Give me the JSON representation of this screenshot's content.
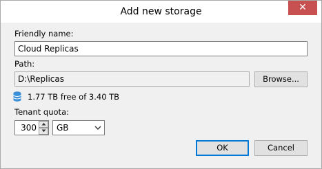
{
  "window": {
    "title": "Add new storage",
    "close_glyph": "✕"
  },
  "form": {
    "friendly_name_label": "Friendly name:",
    "friendly_name_value": "Cloud Replicas",
    "path_label": "Path:",
    "path_value": "D:\\Replicas",
    "browse_label": "Browse...",
    "free_space_text": "1.77 TB free of 3.40 TB",
    "tenant_quota_label": "Tenant quota:",
    "quota_value": "300",
    "quota_unit": "GB"
  },
  "buttons": {
    "ok_label": "OK",
    "cancel_label": "Cancel"
  },
  "icons": {
    "storage": "database-icon",
    "spin_up": "chevron-up-icon",
    "spin_down": "chevron-down-icon",
    "dropdown": "chevron-down-icon",
    "close": "close-icon"
  },
  "colors": {
    "close_button": "#c75050",
    "default_button_border": "#0078d7",
    "database_icon": "#3a8fd6"
  }
}
